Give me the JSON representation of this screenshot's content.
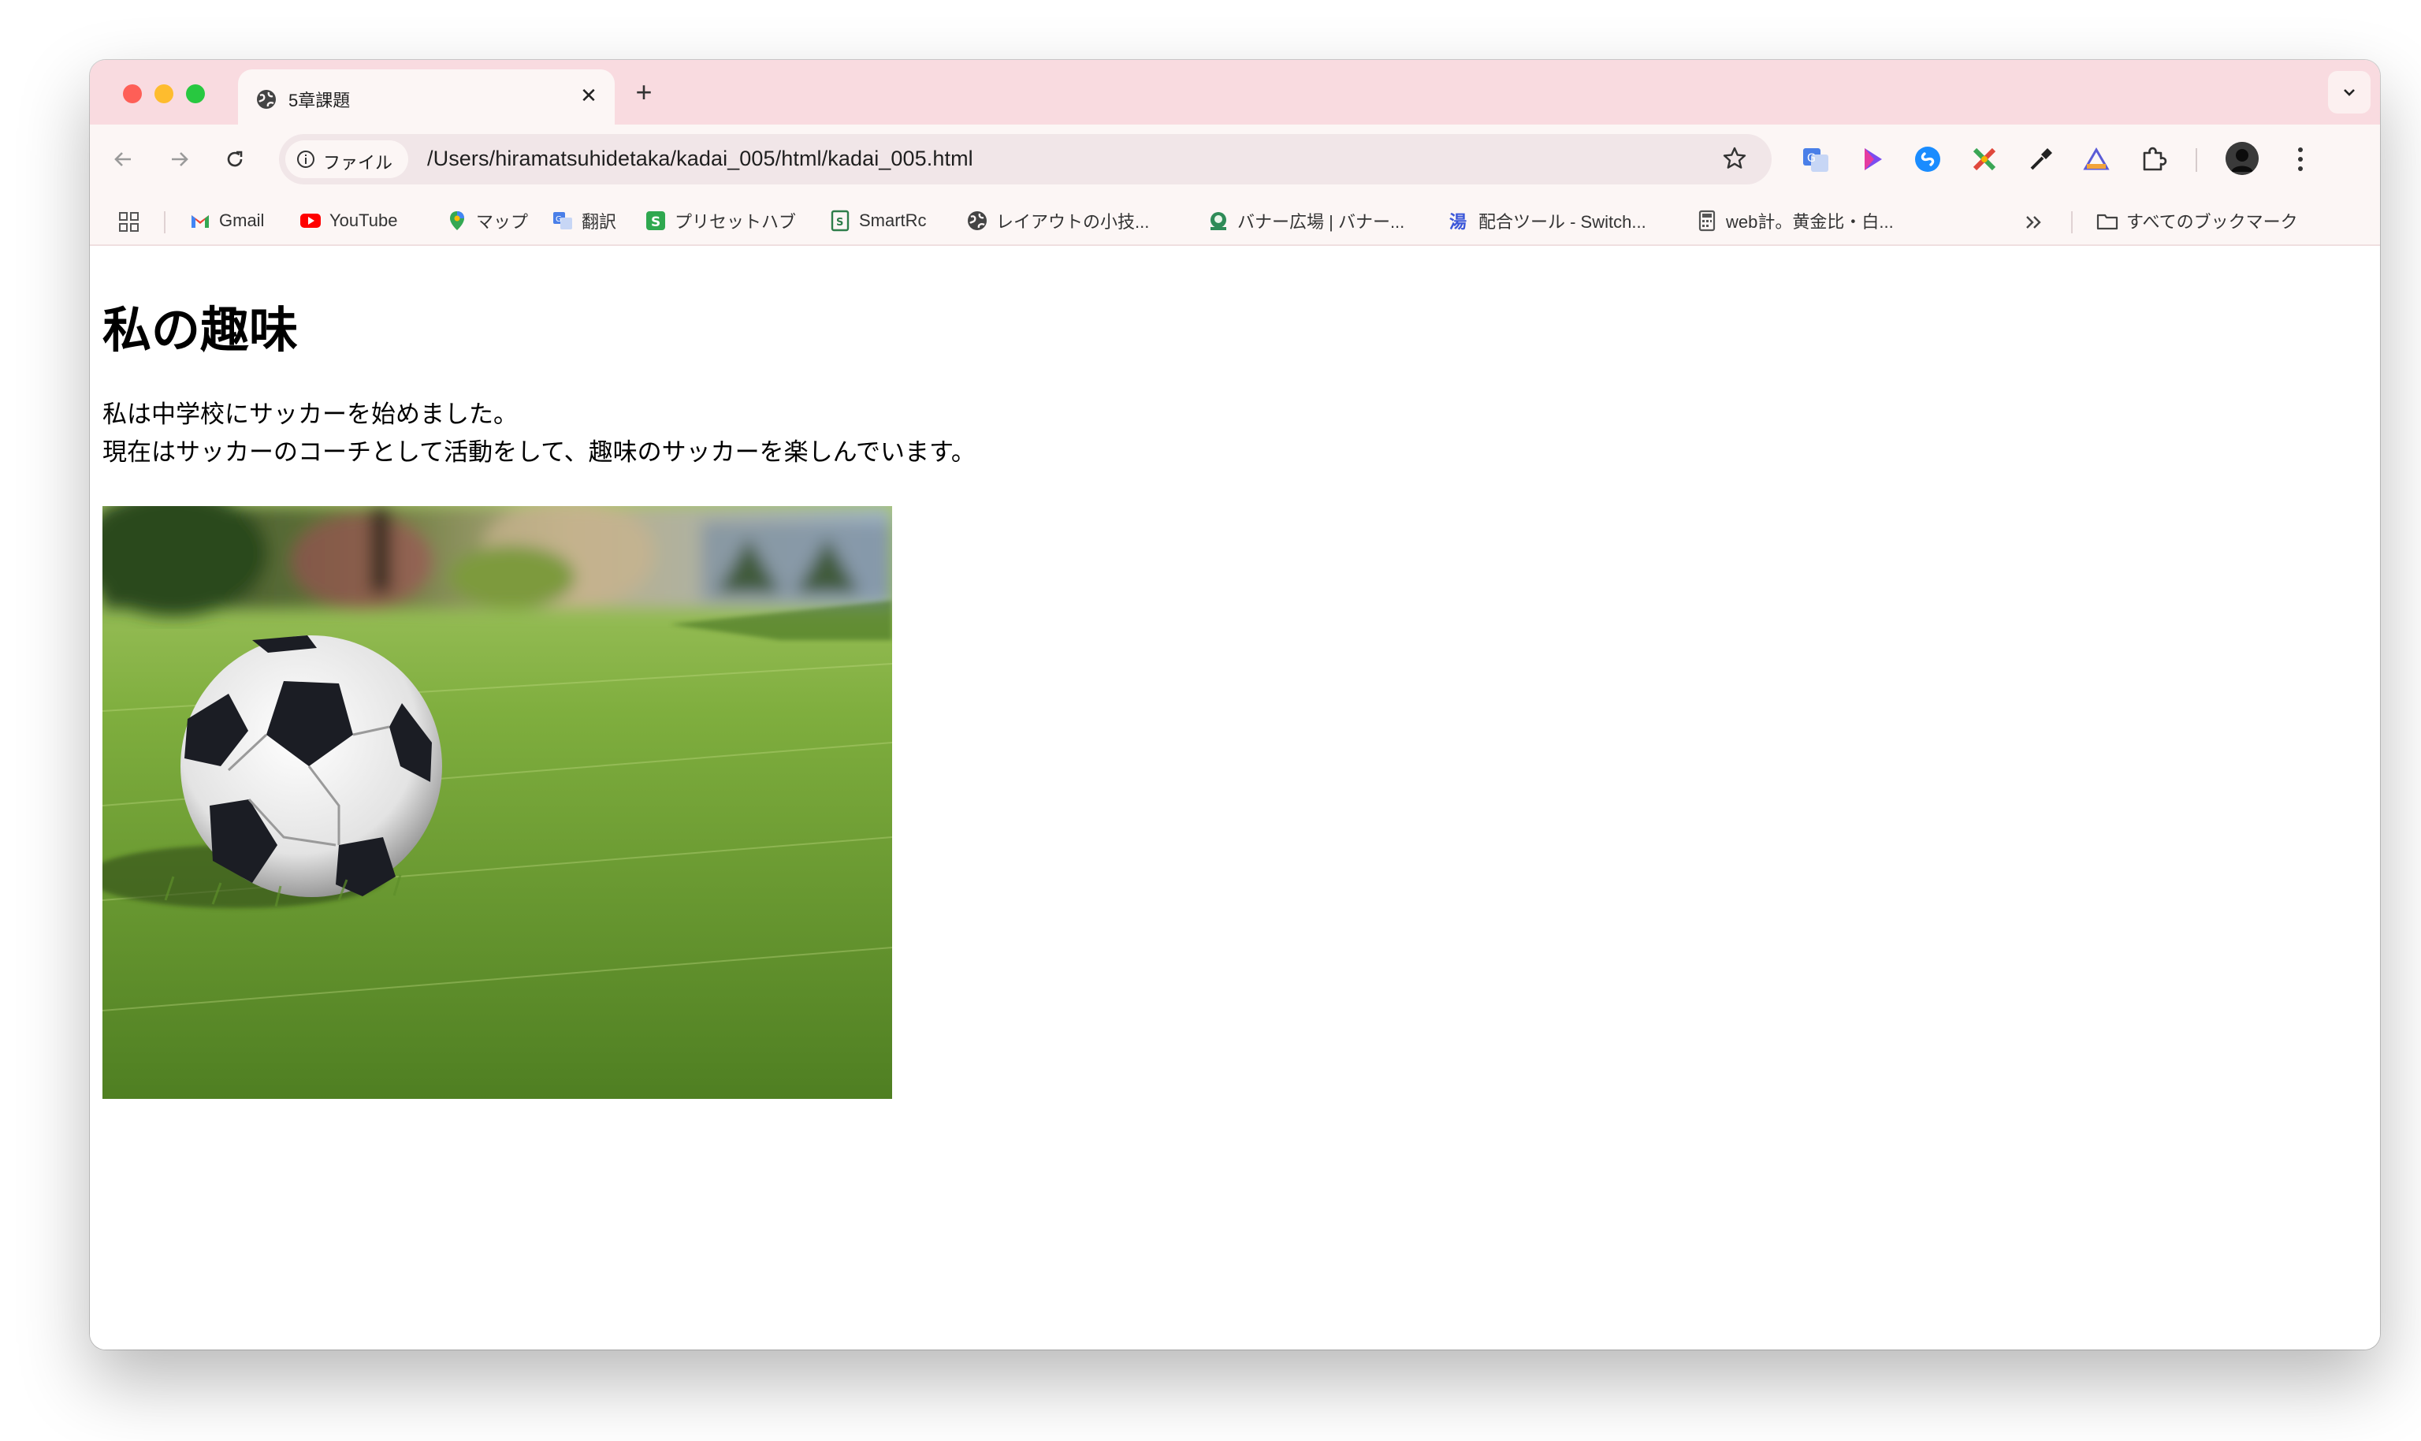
{
  "browser": {
    "tab": {
      "title": "5章課題"
    },
    "address": {
      "chip_label": "ファイル",
      "url": "/Users/hiramatsuhidetaka/kadai_005/html/kadai_005.html"
    }
  },
  "bookmarks": [
    {
      "label": "Gmail",
      "icon": "gmail-icon"
    },
    {
      "label": "YouTube",
      "icon": "youtube-icon"
    },
    {
      "label": "マップ",
      "icon": "maps-icon"
    },
    {
      "label": "翻訳",
      "icon": "translate-icon"
    },
    {
      "label": "プリセットハブ",
      "icon": "preset-hub-icon"
    },
    {
      "label": "SmartRc",
      "icon": "smartrc-icon"
    },
    {
      "label": "レイアウトの小技...",
      "icon": "globe-icon"
    },
    {
      "label": "バナー広場 | バナー...",
      "icon": "banner-icon"
    },
    {
      "label": "配合ツール - Switch...",
      "icon": "switch-icon"
    },
    {
      "label": "web計。黄金比・白...",
      "icon": "calculator-icon"
    }
  ],
  "all_bookmarks_label": "すべてのブックマーク",
  "page": {
    "heading": "私の趣味",
    "lines": [
      "私は中学校にサッカーを始めました。",
      "現在はサッカーのコーチとして活動をして、趣味のサッカーを楽しんでいます。"
    ],
    "image": {
      "alt": "soccer ball on grass"
    }
  },
  "colors": {
    "tab_strip": "#f9dbe0",
    "toolbar": "#fcf6f5",
    "omnibox": "#f1e6e8"
  }
}
